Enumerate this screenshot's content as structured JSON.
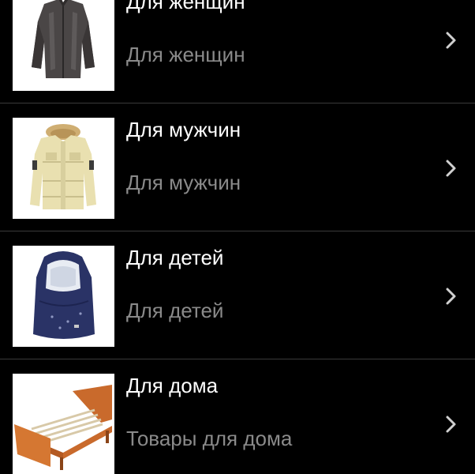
{
  "colors": {
    "background": "#000000",
    "title": "#ffffff",
    "subtitle": "#8a8a8a",
    "divider": "#3a3a3a",
    "chevron": "#d0d0d0"
  },
  "categories": [
    {
      "title": "Для женщин",
      "subtitle": "Для женщин",
      "icon": "womens-jacket-image",
      "chevron": "chevron-right-icon"
    },
    {
      "title": "Для мужчин",
      "subtitle": "Для мужчин",
      "icon": "mens-parka-image",
      "chevron": "chevron-right-icon"
    },
    {
      "title": "Для детей",
      "subtitle": "Для детей",
      "icon": "baby-sleeping-bag-image",
      "chevron": "chevron-right-icon"
    },
    {
      "title": "Для дома",
      "subtitle": "Товары для дома",
      "icon": "bed-frame-image",
      "chevron": "chevron-right-icon"
    }
  ]
}
